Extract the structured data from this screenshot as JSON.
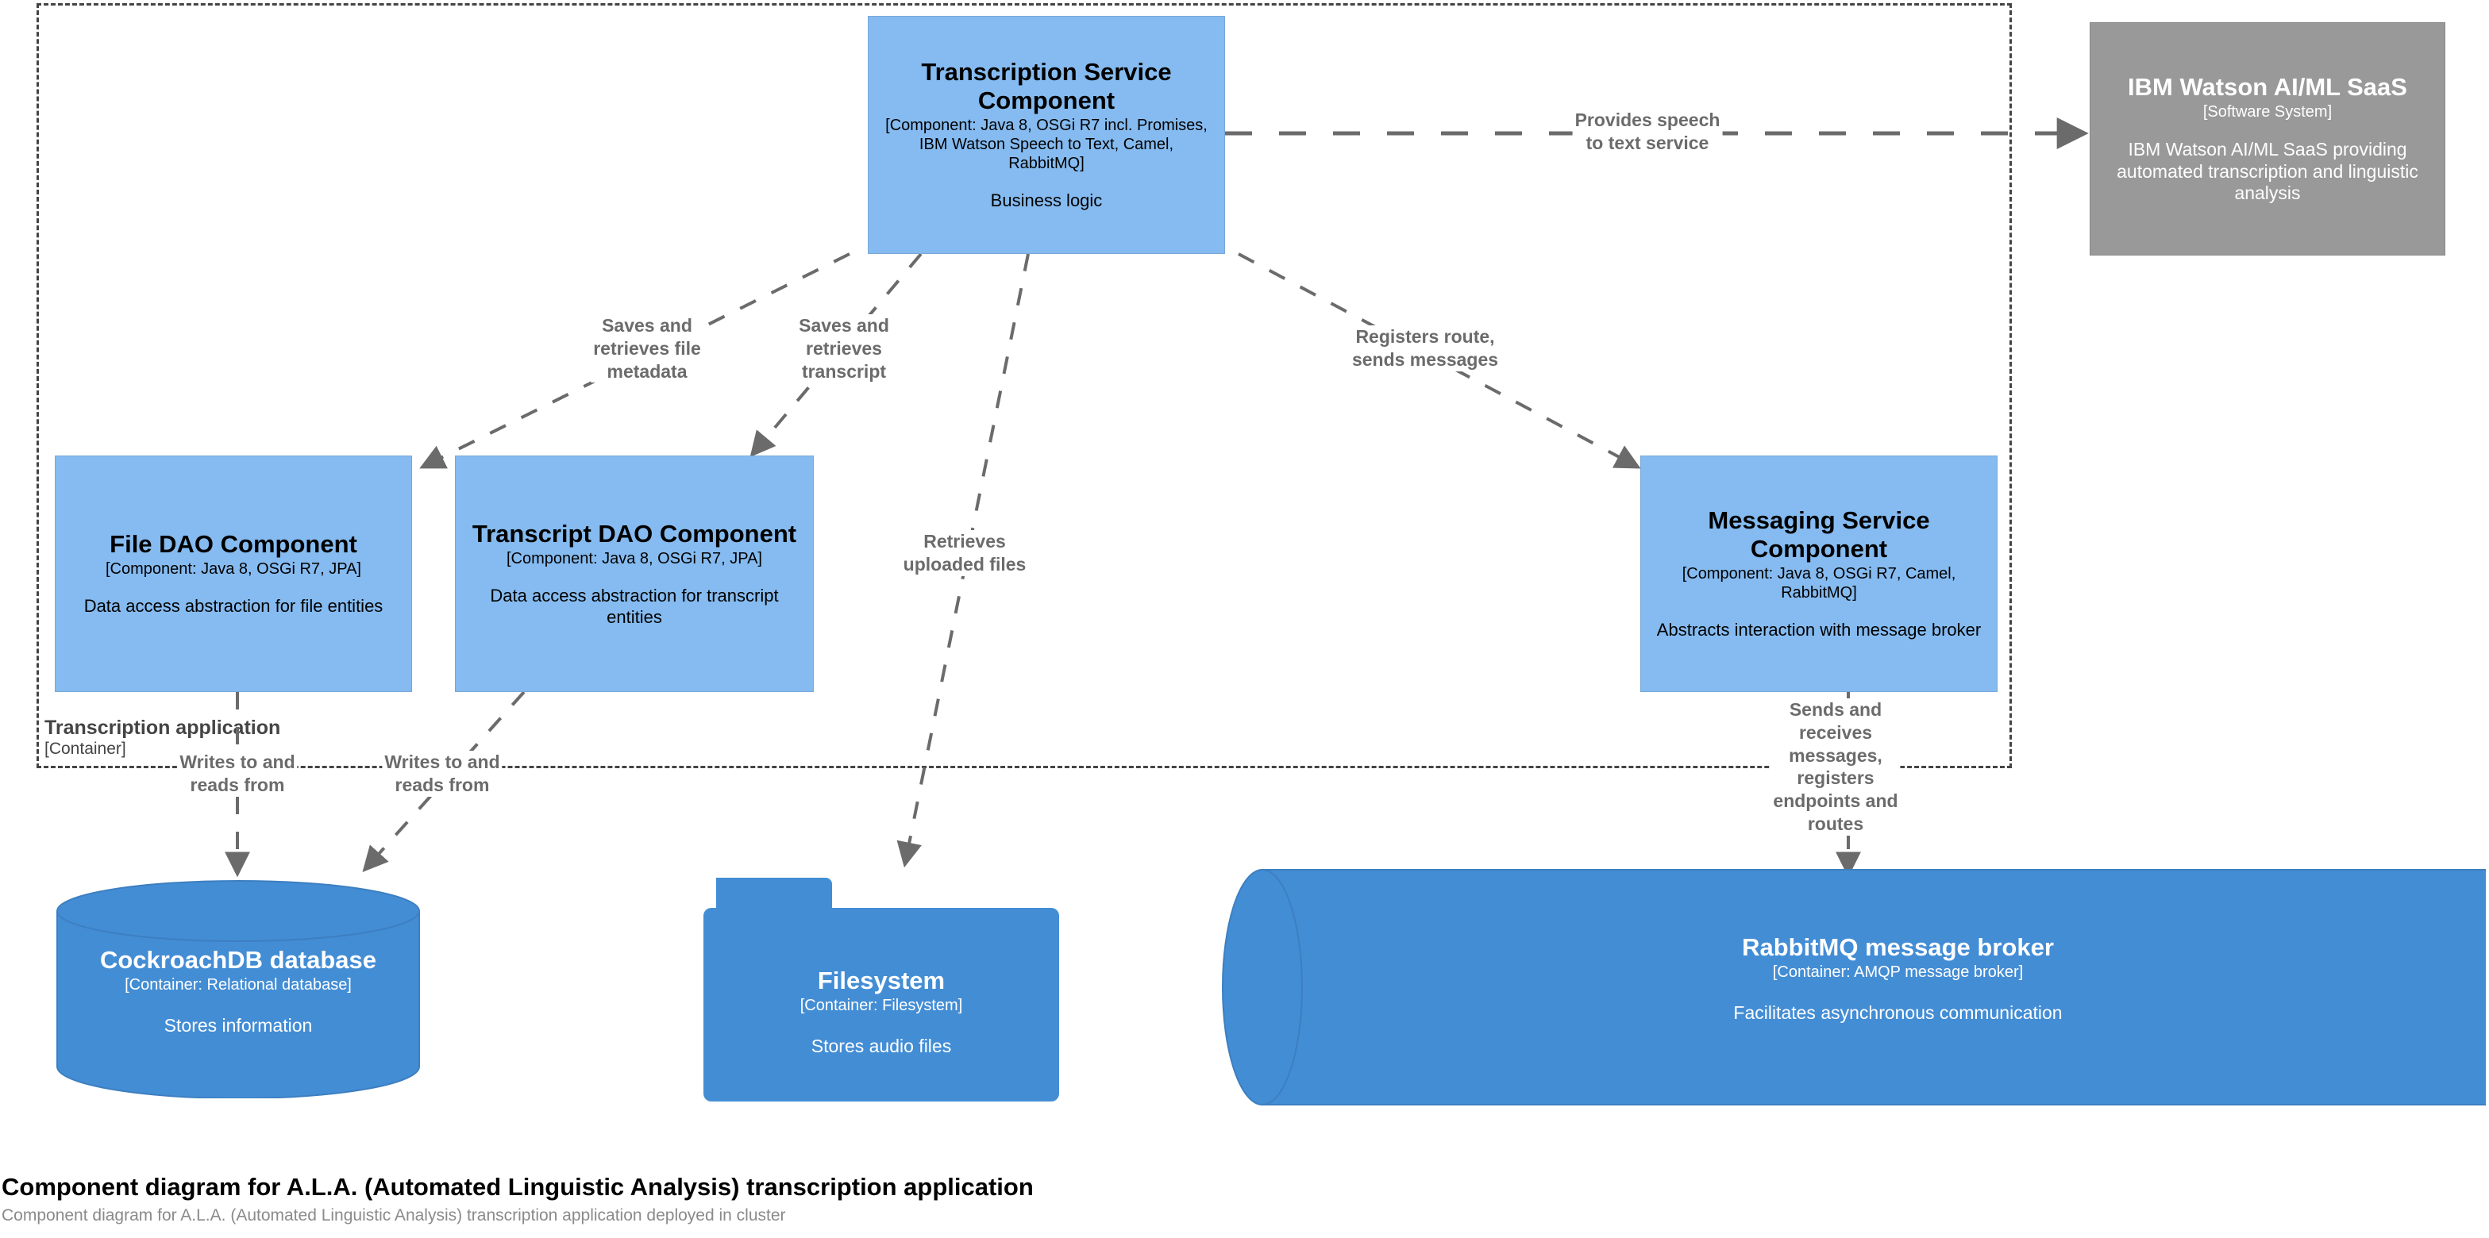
{
  "boundary": {
    "label": "Transcription application",
    "sublabel": "[Container]"
  },
  "nodes": {
    "transcription_service": {
      "title": "Transcription Service Component",
      "tech": "[Component: Java 8, OSGi R7 incl. Promises, IBM Watson Speech to Text, Camel, RabbitMQ]",
      "desc": "Business logic"
    },
    "watson": {
      "title": "IBM Watson AI/ML SaaS",
      "tech": "[Software System]",
      "desc": "IBM Watson AI/ML SaaS providing automated transcription and linguistic analysis"
    },
    "file_dao": {
      "title": "File DAO Component",
      "tech": "[Component: Java 8, OSGi R7, JPA]",
      "desc": "Data access abstraction for file entities"
    },
    "transcript_dao": {
      "title": "Transcript DAO Component",
      "tech": "[Component: Java 8, OSGi R7, JPA]",
      "desc": "Data access abstraction for transcript entities"
    },
    "messaging_service": {
      "title": "Messaging Service Component",
      "tech": "[Component: Java 8, OSGi R7, Camel, RabbitMQ]",
      "desc": "Abstracts interaction with message broker"
    },
    "cockroachdb": {
      "title": "CockroachDB database",
      "tech": "[Container: Relational database]",
      "desc": "Stores information"
    },
    "filesystem": {
      "title": "Filesystem",
      "tech": "[Container: Filesystem]",
      "desc": "Stores audio files"
    },
    "rabbitmq": {
      "title": "RabbitMQ message broker",
      "tech": "[Container: AMQP message broker]",
      "desc": "Facilitates asynchronous communication"
    }
  },
  "edges": [
    {
      "id": "watson",
      "label": "Provides speech\nto text service"
    },
    {
      "id": "file-metadata",
      "label": "Saves and\nretrieves file\nmetadata"
    },
    {
      "id": "transcript",
      "label": "Saves and\nretrieves\ntranscript"
    },
    {
      "id": "messaging",
      "label": "Registers route,\nsends messages"
    },
    {
      "id": "uploaded-files",
      "label": "Retrieves\nuploaded files"
    },
    {
      "id": "filedao-db",
      "label": "Writes to and\nreads from"
    },
    {
      "id": "transcriptdao-db",
      "label": "Writes to and\nreads from"
    },
    {
      "id": "messaging-broker",
      "label": "Sends and\nreceives\nmessages,\nregisters\nendpoints and\nroutes"
    }
  ],
  "caption": {
    "title": "Component diagram for A.L.A. (Automated Linguistic Analysis) transcription application",
    "subtitle": "Component diagram for A.L.A. (Automated Linguistic Analysis) transcription application deployed in cluster"
  },
  "colors": {
    "component": "#85bbf0",
    "container": "#438dd5",
    "external": "#999999",
    "edge": "#6b6b6b",
    "boundary": "#444444"
  }
}
